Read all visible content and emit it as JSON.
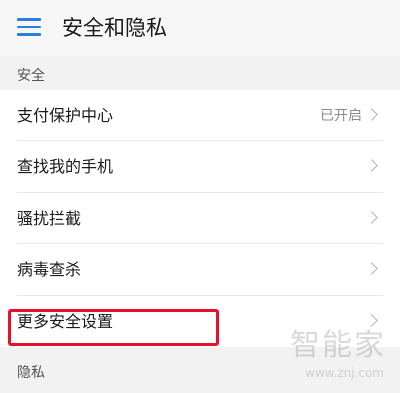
{
  "header": {
    "title": "安全和隐私",
    "menu_icon": "hamburger-menu-icon",
    "accent_color": "#2a7de1"
  },
  "sections": {
    "security_label": "安全",
    "privacy_label": "隐私"
  },
  "security_items": [
    {
      "label": "支付保护中心",
      "value": "已开启"
    },
    {
      "label": "查找我的手机",
      "value": ""
    },
    {
      "label": "骚扰拦截",
      "value": ""
    },
    {
      "label": "病毒查杀",
      "value": ""
    },
    {
      "label": "更多安全设置",
      "value": ""
    }
  ],
  "highlight_color": "#e8112d",
  "watermark": {
    "title": "智能家",
    "url": "www.znj.com"
  }
}
